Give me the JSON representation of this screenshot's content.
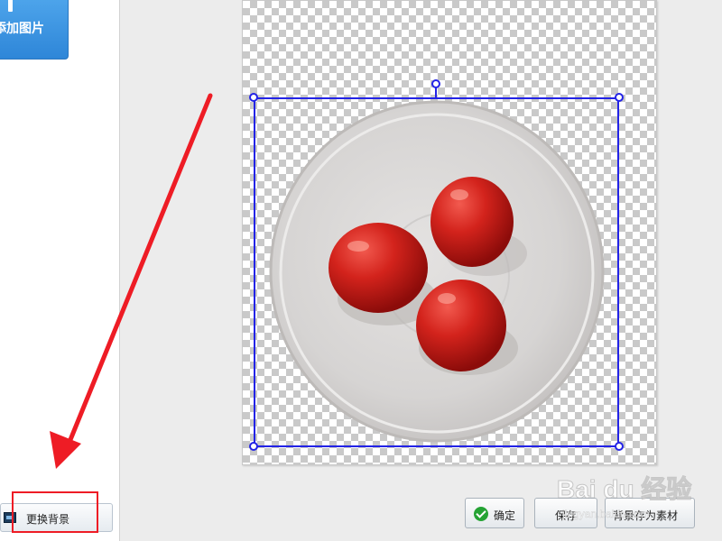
{
  "sidebar": {
    "add_image_label": "添加图片",
    "change_bg_label": "更换背景"
  },
  "footer": {
    "confirm_label": "确定",
    "save_label": "保存",
    "save_as_material_label": "背景存为素材"
  },
  "watermark": {
    "brand": "Bai du 经验",
    "sub": "jingyan.baidu.com"
  },
  "colors": {
    "selection": "#2323e6",
    "annotation": "#ee1c25",
    "confirm_check": "#25a334",
    "primary_button": "#2e86d8"
  },
  "icons": {
    "add": "plus-icon",
    "change_bg": "picture-icon",
    "confirm": "check-icon"
  }
}
